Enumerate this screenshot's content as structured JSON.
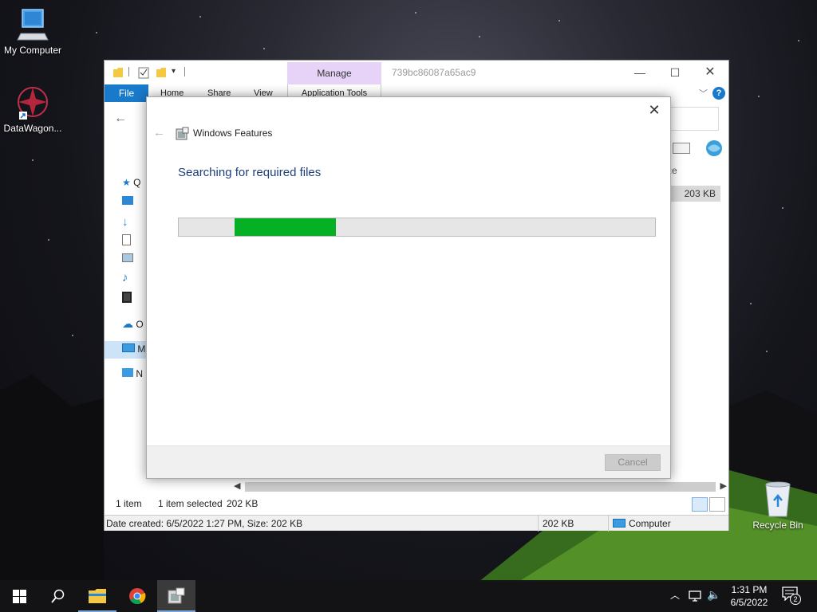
{
  "desktop": {
    "icons": [
      {
        "label": "My Computer",
        "icon": "computer-icon"
      },
      {
        "label": "DataWagon...",
        "icon": "datawagon-shortcut-icon"
      },
      {
        "label": "Recycle Bin",
        "icon": "recycle-bin-icon"
      }
    ]
  },
  "explorer": {
    "title": "739bc86087a65ac9",
    "manage_label": "Manage",
    "tabs": {
      "file": "File",
      "home": "Home",
      "share": "Share",
      "view": "View",
      "application_tools": "Application Tools"
    },
    "help": "?",
    "column_header_partial": "ze",
    "file_size": "203 KB",
    "nav_items": [
      {
        "letter": "Q",
        "icon": "quick-access-star-icon"
      },
      {
        "letter": "",
        "icon": "desktop-folder-icon"
      },
      {
        "letter": "",
        "icon": "downloads-arrow-icon"
      },
      {
        "letter": "",
        "icon": "documents-icon"
      },
      {
        "letter": "",
        "icon": "pictures-icon"
      },
      {
        "letter": "",
        "icon": "music-note-icon"
      },
      {
        "letter": "",
        "icon": "videos-icon"
      },
      {
        "letter": "O",
        "icon": "onedrive-cloud-icon"
      },
      {
        "letter": "M",
        "icon": "this-pc-icon"
      },
      {
        "letter": "N",
        "icon": "network-icon"
      }
    ],
    "status": {
      "item_count": "1 item",
      "selected": "1 item selected",
      "selected_size": "202 KB"
    },
    "details": {
      "info": "Date created: 6/5/2022 1:27 PM, Size: 202 KB",
      "size": "202 KB",
      "location": "Computer"
    }
  },
  "dialog": {
    "title": "Windows Features",
    "heading": "Searching for required files",
    "progress_start": 0.118,
    "progress_end": 0.33,
    "progress_color": "#06b025",
    "cancel_label": "Cancel"
  },
  "taskbar": {
    "apps": [
      "start-icon",
      "search-icon",
      "file-explorer-icon",
      "chrome-icon",
      "windows-features-icon"
    ],
    "time": "1:31 PM",
    "date": "6/5/2022",
    "notifications_count": "2"
  }
}
